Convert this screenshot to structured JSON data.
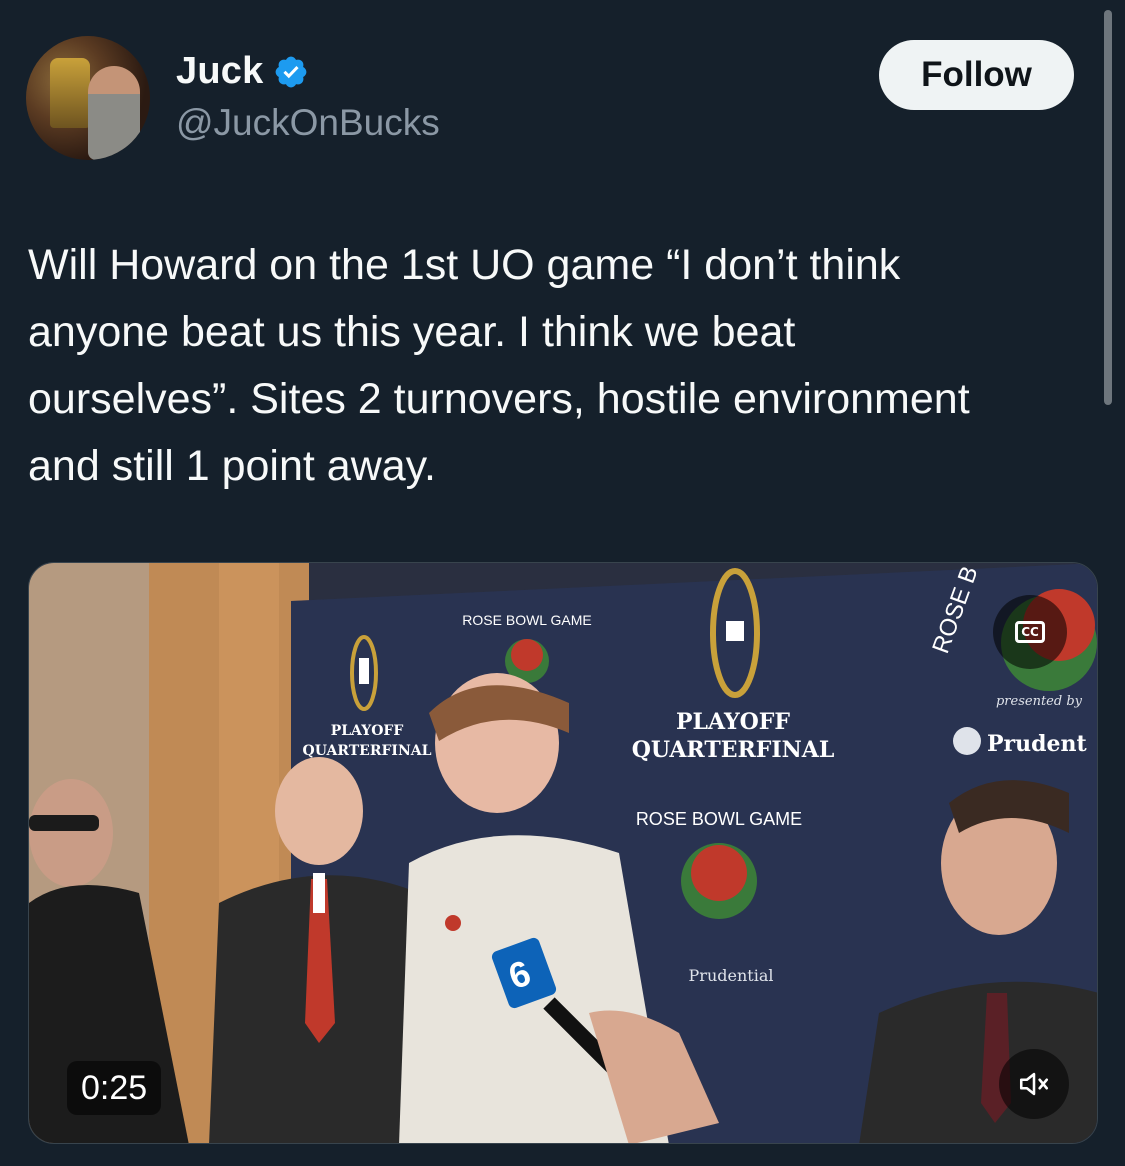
{
  "author": {
    "display_name": "Juck",
    "handle": "@JuckOnBucks",
    "verified": true,
    "avatar_icon": "avatar-photo"
  },
  "actions": {
    "follow_label": "Follow"
  },
  "tweet": {
    "text_lines": [
      "Will Howard on the 1st UO game “I don’t think",
      "anyone beat us this year. I think we beat",
      "ourselves”. Sites 2 turnovers, hostile environment",
      "and still 1 point away."
    ]
  },
  "video": {
    "duration": "0:25",
    "cc_label": "CC",
    "backdrop_text": {
      "playoff": "PLAYOFF",
      "quarterfinal": "QUARTERFINAL",
      "rose_bowl_game": "ROSE BOWL GAME",
      "rose_top": "ROSE B",
      "presented_by": "presented by",
      "sponsor": "Prudential",
      "sponsor_cut": "Prudent",
      "mic_flag": "6"
    }
  },
  "colors": {
    "background": "#15202b",
    "text_primary": "#f7f9f9",
    "text_secondary": "#8b98a5",
    "verified_blue": "#1d9bf0",
    "follow_bg": "#eff3f4",
    "follow_text": "#0f1419"
  }
}
